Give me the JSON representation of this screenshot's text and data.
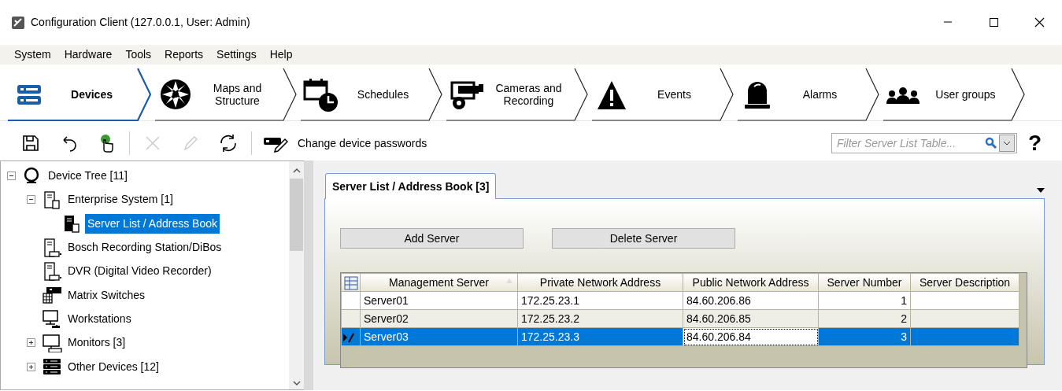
{
  "window": {
    "title": "Configuration Client (127.0.0.1, User: Admin)"
  },
  "menu": [
    "System",
    "Hardware",
    "Tools",
    "Reports",
    "Settings",
    "Help"
  ],
  "ribbon": [
    {
      "label": "Devices",
      "kind": "devices",
      "selected": true
    },
    {
      "label": "Maps and Structure",
      "kind": "maps",
      "selected": false
    },
    {
      "label": "Schedules",
      "kind": "schedules",
      "selected": false
    },
    {
      "label": "Cameras and Recording",
      "kind": "cameras",
      "selected": false
    },
    {
      "label": "Events",
      "kind": "events",
      "selected": false
    },
    {
      "label": "Alarms",
      "kind": "alarms",
      "selected": false
    },
    {
      "label": "User groups",
      "kind": "users",
      "selected": false
    }
  ],
  "toolbar": [
    {
      "kind": "save",
      "disabled": false
    },
    {
      "kind": "undo",
      "disabled": false
    },
    {
      "kind": "activate",
      "disabled": false
    },
    {
      "kind": "separator"
    },
    {
      "kind": "delete",
      "disabled": true
    },
    {
      "kind": "rename",
      "disabled": true
    },
    {
      "kind": "refresh",
      "disabled": false
    },
    {
      "kind": "separator"
    },
    {
      "kind": "passwords",
      "label": "Change device passwords",
      "disabled": false
    }
  ],
  "filter": {
    "placeholder": "Filter Server List Table..."
  },
  "help": "?",
  "tree": [
    {
      "label": "Device Tree [11]",
      "kind": "root",
      "selected": false,
      "expanded": true,
      "children": [
        {
          "label": "Enterprise System [1]",
          "kind": "server",
          "selected": false,
          "expanded": true,
          "children": [
            {
              "label": "Server List / Address Book",
              "kind": "serverlist",
              "selected": true
            }
          ]
        },
        {
          "label": "Bosch Recording Station/DiBos",
          "kind": "recorder",
          "selected": false
        },
        {
          "label": "DVR (Digital Video Recorder)",
          "kind": "recorder",
          "selected": false
        },
        {
          "label": "Matrix Switches",
          "kind": "matrix",
          "selected": false
        },
        {
          "label": "Workstations",
          "kind": "workstation",
          "selected": false
        },
        {
          "label": "Monitors [3]",
          "kind": "monitor",
          "selected": false,
          "expanded": false
        },
        {
          "label": "Other Devices [12]",
          "kind": "rack",
          "selected": false,
          "expanded": false
        }
      ]
    }
  ],
  "panel": {
    "tab": "Server List / Address Book [3]",
    "buttons": [
      "Add Server",
      "Delete Server"
    ],
    "table": {
      "columns": [
        {
          "label": "Management Server",
          "sorted": true
        },
        {
          "label": "Private Network Address",
          "sorted": false
        },
        {
          "label": "Public Network Address",
          "sorted": false
        },
        {
          "label": "Server Number",
          "sorted": false
        },
        {
          "label": "Server Description",
          "sorted": false
        }
      ],
      "rows": [
        {
          "selected": false,
          "editing": false,
          "cells": [
            {
              "text": "Server01",
              "focused": false
            },
            {
              "text": "172.25.23.1",
              "focused": false
            },
            {
              "text": "84.60.206.86",
              "focused": false
            },
            {
              "text": "1",
              "focused": false
            }
          ]
        },
        {
          "selected": false,
          "editing": false,
          "cells": [
            {
              "text": "Server02",
              "focused": false
            },
            {
              "text": "172.25.23.2",
              "focused": false
            },
            {
              "text": "84.60.206.85",
              "focused": false
            },
            {
              "text": "2",
              "focused": false
            }
          ]
        },
        {
          "selected": true,
          "editing": true,
          "cells": [
            {
              "text": "Server03",
              "focused": false
            },
            {
              "text": "172.25.23.3",
              "focused": false
            },
            {
              "text": "84.60.206.84",
              "focused": true
            },
            {
              "text": "3",
              "focused": false
            }
          ]
        }
      ]
    }
  }
}
